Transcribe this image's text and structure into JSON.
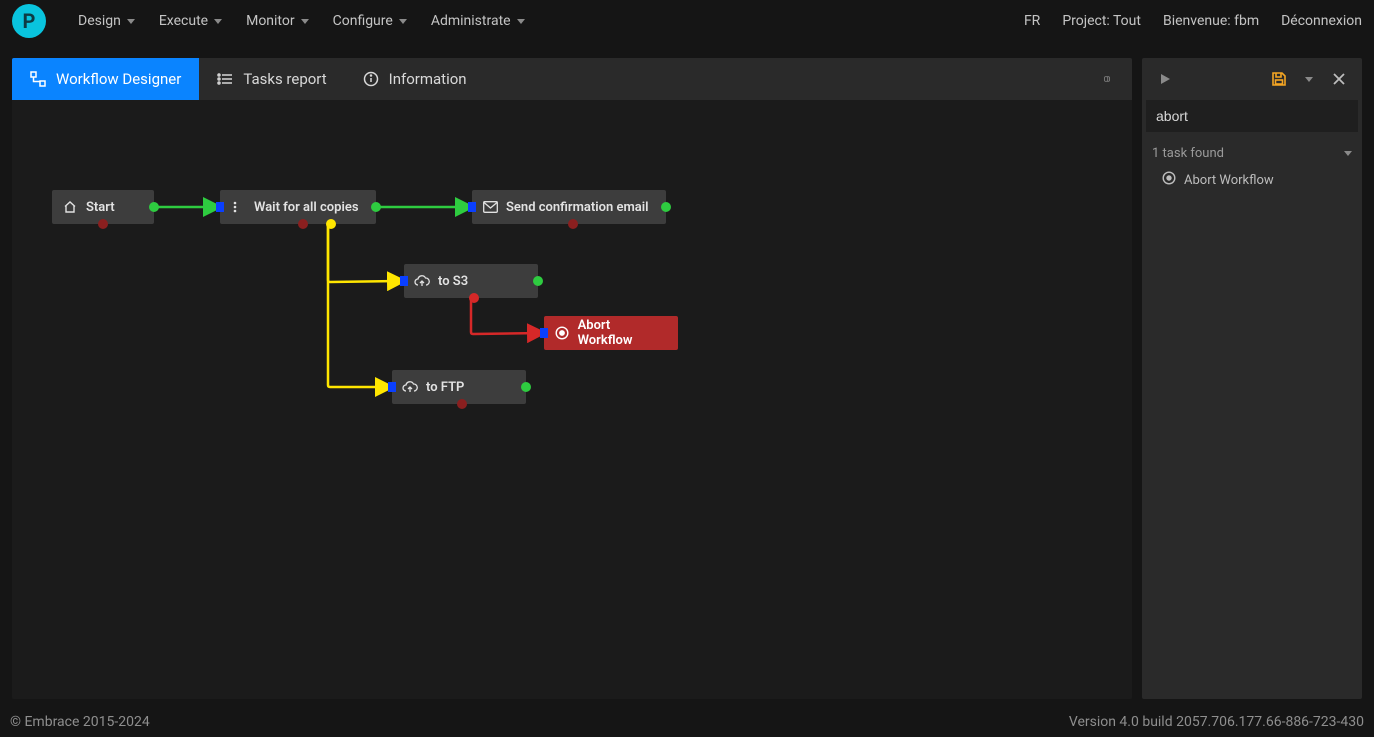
{
  "logo_letter": "P",
  "top_menu": {
    "design": "Design",
    "execute": "Execute",
    "monitor": "Monitor",
    "configure": "Configure",
    "administrate": "Administrate"
  },
  "top_right": {
    "lang": "FR",
    "project": "Project: Tout",
    "welcome": "Bienvenue: fbm",
    "logout": "Déconnexion"
  },
  "tabs": {
    "designer": "Workflow Designer",
    "tasks_report": "Tasks report",
    "information": "Information"
  },
  "nodes": {
    "start": "Start",
    "wait": "Wait for all copies",
    "email": "Send confirmation email",
    "to_s3": "to S3",
    "to_ftp": "to FTP",
    "abort": "Abort Workflow"
  },
  "sidepanel": {
    "search_value": "abort",
    "found_header": "1 task found",
    "found_item": "Abort Workflow"
  },
  "footer": {
    "copyright": "© Embrace 2015-2024",
    "version": "Version 4.0 build 2057.706.177.66-886-723-430"
  }
}
